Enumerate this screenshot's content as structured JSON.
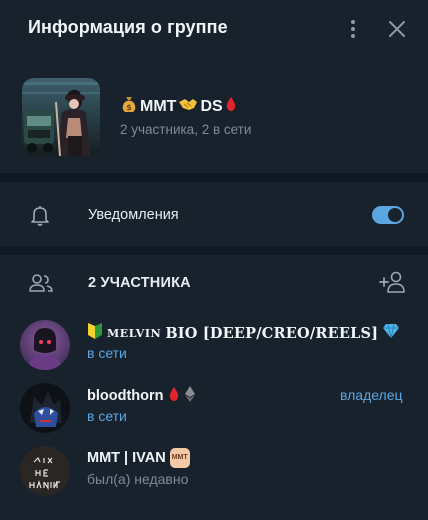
{
  "header": {
    "title": "Информация о группе",
    "menu_icon": "more-vertical-icon",
    "close_icon": "close-icon"
  },
  "group": {
    "name_text_1": "MMT",
    "name_text_2": "DS",
    "name_icons": [
      "money-bag-icon",
      "handshake-icon",
      "drop-of-blood-icon"
    ],
    "subtitle": "2 участника, 2 в сети"
  },
  "notifications": {
    "label": "Уведомления",
    "enabled": true,
    "icon": "bell-icon"
  },
  "members_section": {
    "label": "2 УЧАСТНИКА",
    "icon": "people-icon",
    "add_icon": "add-user-icon"
  },
  "members": [
    {
      "name_prefix": "MELVIN",
      "name_main": "BIO [DEEP/CREO/REELS]",
      "status": "в сети",
      "online": true,
      "icons": [
        "beginner-badge-icon",
        "gem-icon"
      ]
    },
    {
      "name": "bloodthorn",
      "status": "в сети",
      "online": true,
      "role": "владелец",
      "icons": [
        "drop-of-blood-icon",
        "ethereum-icon"
      ]
    },
    {
      "name": "MMT | IVAN",
      "status": "был(а) недавно",
      "online": false,
      "badge": "MMT"
    }
  ],
  "colors": {
    "background": "#18222d",
    "separator": "#101923",
    "accent": "#5aa6e0",
    "muted_text": "#7a8a9c"
  }
}
